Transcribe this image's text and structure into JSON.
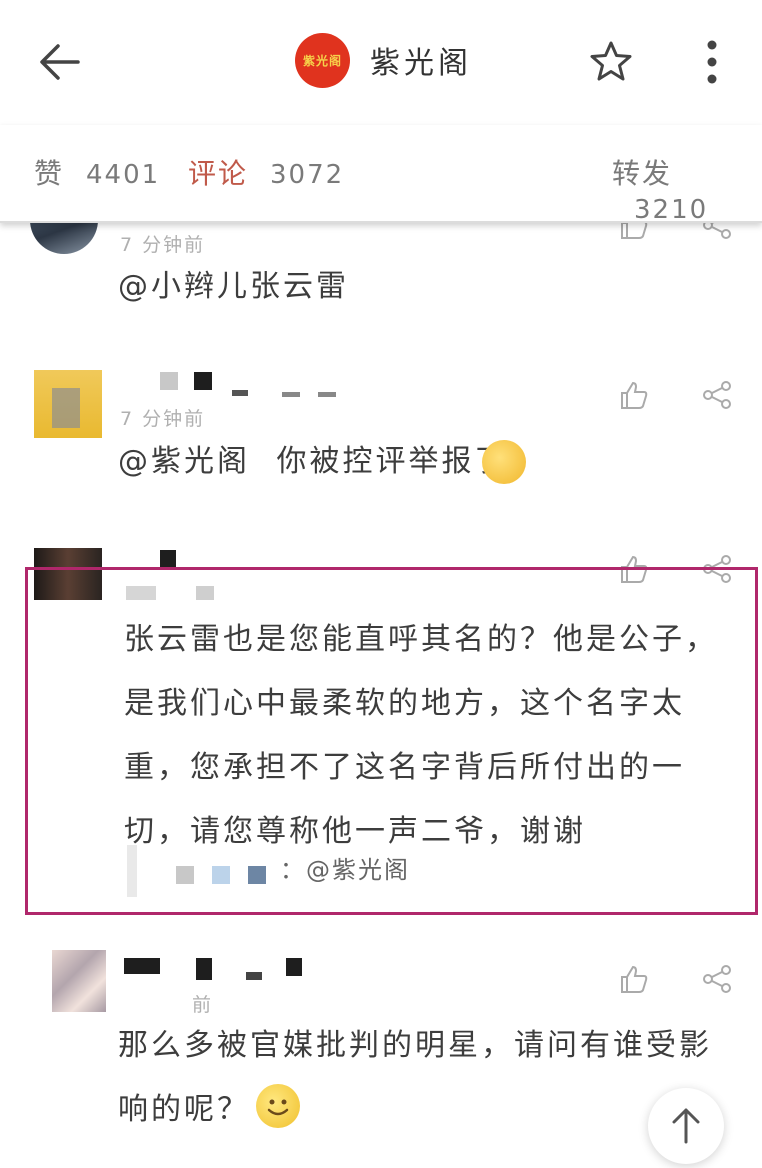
{
  "header": {
    "back_icon": "arrow-left-icon",
    "logo_text": "紫光阁",
    "title": "紫光阁",
    "star_icon": "star-icon",
    "more_icon": "more-vertical-icon"
  },
  "stats": {
    "likes_label": "赞",
    "likes_count": "4401",
    "comments_label": "评论",
    "comments_count": "3072",
    "reposts_label": "转发",
    "reposts_count": "3210"
  },
  "comments": [
    {
      "time": "7 分钟前",
      "text": "@小辫儿张云雷"
    },
    {
      "time": "7 分钟前",
      "text_mention": "@紫光阁",
      "text": "你被控评举报了"
    },
    {
      "lines": [
        "张云雷也是您能直呼其名的？他是公子，",
        "是我们心中最柔软的地方，这个名字太",
        "重，您承担不了这名字背后所付出的一",
        "切，请您尊称他一声二爷，谢谢"
      ],
      "reply_to": "：@紫光阁"
    },
    {
      "time": "前",
      "lines": [
        "那么多被官媒批判的明星，请问有谁受影",
        "响的呢？"
      ]
    }
  ],
  "colors": {
    "highlight_border": "#b0276b",
    "logo_bg": "#e0331e",
    "comments_label": "#c05a4a"
  }
}
